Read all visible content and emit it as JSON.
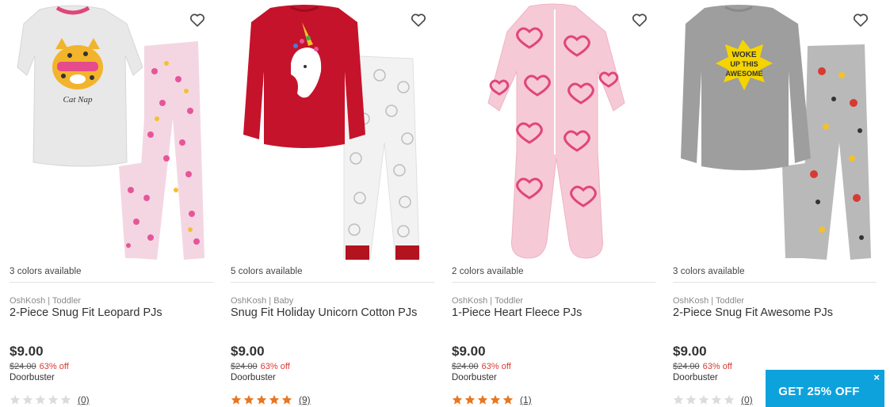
{
  "products": [
    {
      "colors_available": "3 colors available",
      "brand": "OshKosh | Toddler",
      "name": "2-Piece Snug Fit Leopard PJs",
      "price": "$9.00",
      "was_price": "$24.00",
      "discount": "63% off",
      "tag": "Doorbuster",
      "rating": 0,
      "review_count": "(0)",
      "image_icon": "leopard-pajama-set-image"
    },
    {
      "colors_available": "5 colors available",
      "brand": "OshKosh | Baby",
      "name": "Snug Fit Holiday Unicorn Cotton PJs",
      "price": "$9.00",
      "was_price": "$24.00",
      "discount": "63% off",
      "tag": "Doorbuster",
      "rating": 5,
      "review_count": "(9)",
      "image_icon": "unicorn-pajama-set-image"
    },
    {
      "colors_available": "2 colors available",
      "brand": "OshKosh | Toddler",
      "name": "1-Piece Heart Fleece PJs",
      "price": "$9.00",
      "was_price": "$24.00",
      "discount": "63% off",
      "tag": "Doorbuster",
      "rating": 5,
      "review_count": "(1)",
      "image_icon": "heart-footed-pajama-image"
    },
    {
      "colors_available": "3 colors available",
      "brand": "OshKosh | Toddler",
      "name": "2-Piece Snug Fit Awesome PJs",
      "price": "$9.00",
      "was_price": "$24.00",
      "discount": "63% off",
      "tag": "Doorbuster",
      "rating": 0,
      "review_count": "(0)",
      "image_icon": "awesome-pajama-set-image"
    }
  ],
  "image_texts": {
    "leopard": "Cat Nap",
    "awesome_1": "WOKE",
    "awesome_2": "UP THIS",
    "awesome_3": "AWESOME"
  },
  "promo": {
    "label": "GET 25% OFF",
    "close": "×"
  },
  "colors": {
    "star_filled": "#e87722",
    "star_empty": "#dcdcdc",
    "discount": "#d83a33",
    "promo_bg": "#0ea2dc"
  }
}
